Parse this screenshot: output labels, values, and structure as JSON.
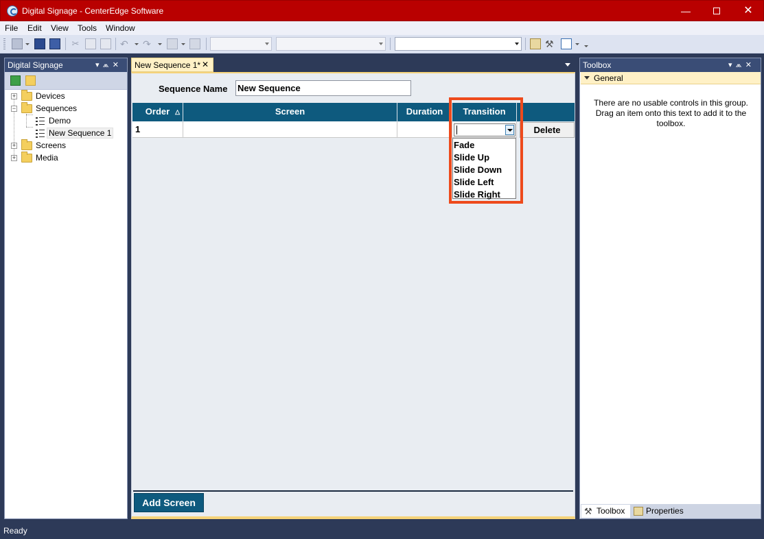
{
  "window": {
    "title": "Digital Signage - CenterEdge Software",
    "minimize": "—",
    "close": "✕"
  },
  "menu": [
    "File",
    "Edit",
    "View",
    "Tools",
    "Window"
  ],
  "left_panel": {
    "title": "Digital Signage",
    "pin": "▾  ⩕  ✕",
    "tree": [
      {
        "label": "Devices",
        "expander": "+"
      },
      {
        "label": "Sequences",
        "expander": "−"
      },
      {
        "label": "Demo"
      },
      {
        "label": "New Sequence 1",
        "selected": true
      },
      {
        "label": "Screens",
        "expander": "+"
      },
      {
        "label": "Media",
        "expander": "+"
      }
    ]
  },
  "document": {
    "tab_label": "New Sequence 1*",
    "tab_close": "✕",
    "sequence_name_label": "Sequence Name",
    "sequence_name_value": "New Sequence",
    "columns": [
      "Order",
      "Screen",
      "Duration",
      "Transition"
    ],
    "sort_indicator": "△",
    "row": {
      "order": "1",
      "screen": "",
      "duration": "",
      "transition": ""
    },
    "delete_label": "Delete",
    "transition_options": [
      "Fade",
      "Slide Up",
      "Slide Down",
      "Slide Left",
      "Slide Right"
    ],
    "add_screen_label": "Add Screen"
  },
  "right_panel": {
    "title": "Toolbox",
    "pin": "▾  ⩕  ✕",
    "group": "General",
    "empty_message": "There are no usable controls in this group. Drag an item onto this text to add it to the toolbox.",
    "tabs": [
      "Toolbox",
      "Properties"
    ]
  },
  "status": "Ready",
  "colors": {
    "titlebar": "#b90000",
    "grid_header": "#0e5a7e",
    "highlight": "#ee4a1c",
    "panel_header": "#3a4d76"
  }
}
